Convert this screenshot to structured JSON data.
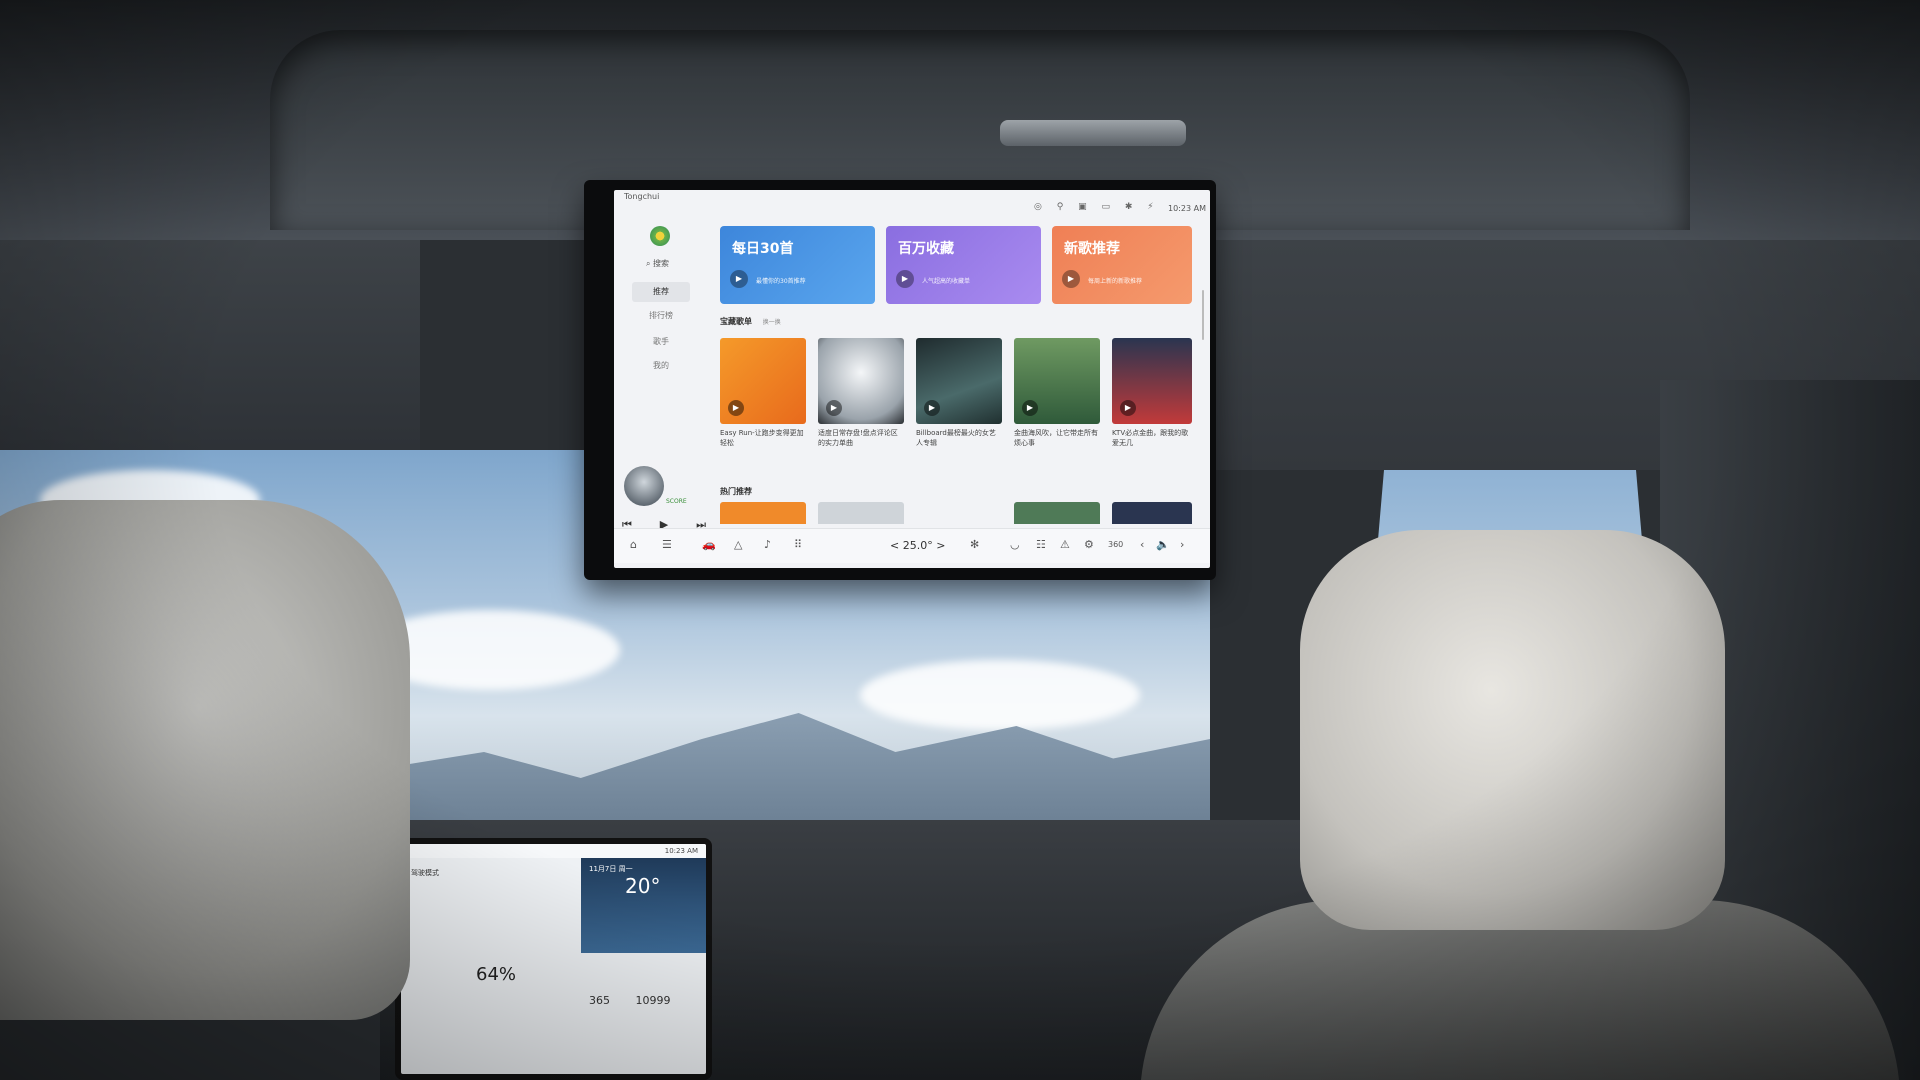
{
  "rear_display": {
    "app_name": "Tongchui",
    "clock": "10:23 AM",
    "status_icons": "◎ ⚲ ▣ ▭ ✱ ⚡",
    "nav": {
      "search_label": "搜索",
      "items": [
        "推荐",
        "排行榜",
        "歌手",
        "我的"
      ],
      "active_index": 0
    },
    "featured_cards": [
      {
        "title": "每日30首",
        "subtitle": "最懂你的30首推荐",
        "color": "#3d86db"
      },
      {
        "title": "百万收藏",
        "subtitle": "人气超高的收藏单",
        "color": "#8a6ee0"
      },
      {
        "title": "新歌推荐",
        "subtitle": "每周上新的新歌推荐",
        "color": "#ef7f55"
      }
    ],
    "section_playlists": {
      "title": "宝藏歌单",
      "more": "换一换"
    },
    "playlists": [
      {
        "caption": "Easy Run-让跑步变得更加轻松",
        "color": "#f08a2a"
      },
      {
        "caption": "适度日常存盘!盘点评论区的实力单曲",
        "color": "#d9dde2"
      },
      {
        "caption": "Billboard最榜最火的女艺人专辑",
        "color": "#2b3a3a"
      },
      {
        "caption": "金曲海风吹，让它带走所有烦心事",
        "color": "#3f6c45"
      },
      {
        "caption": "KTV必点金曲，跟我的歌爱无几",
        "color": "#2a3550"
      }
    ],
    "section_hot": {
      "title": "热门推荐"
    },
    "player": {
      "badge": "SCORE",
      "prev": "⏮",
      "play": "▶",
      "next": "⏭"
    },
    "dock": {
      "icons_left": [
        "⌂",
        "☰",
        "🚗",
        "△",
        "♪",
        "⠿"
      ],
      "temperature": "< 25.0° >",
      "fan": "✻",
      "icons_right": [
        "◡",
        "☷",
        "⚠",
        "⚙",
        "360",
        "‹",
        "🔈",
        "›"
      ]
    }
  },
  "front_display": {
    "clock": "10:23 AM",
    "date": "11月7日 周一",
    "temperature": "20°",
    "vehicle_info": "驾驶模式",
    "battery_percent": "64%",
    "stat_1": "365",
    "stat_2": "10999"
  },
  "colors": {
    "accent_blue": "#3d86db",
    "accent_purple": "#8a6ee0",
    "accent_orange": "#ef7f55"
  }
}
